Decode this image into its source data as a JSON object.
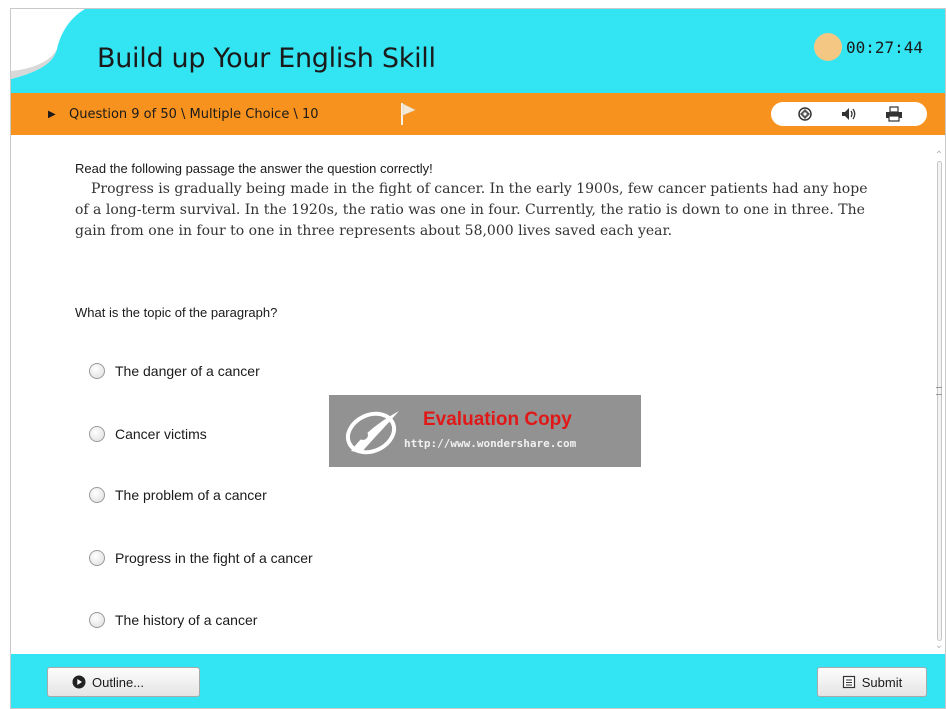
{
  "app": {
    "title": "Build up Your English Skill",
    "timer": "00:27:44"
  },
  "question_bar": {
    "text": "Question 9 of 50 \\ Multiple Choice \\ 10"
  },
  "tools": {
    "icons": [
      "tag-icon",
      "audio-icon",
      "print-icon"
    ]
  },
  "content": {
    "instruction": "Read the following passage the answer the question correctly!",
    "passage": "Progress is gradually being made in the fight of cancer. In the early 1900s, few cancer patients had any hope of a long-term survival. In the 1920s, the ratio was one in four. Currently, the ratio is down to one in three. The gain from one in four to one in three represents about 58,000 lives saved each year.",
    "question": "What is the topic of the paragraph?",
    "options": [
      "The danger of a cancer",
      "Cancer victims",
      "The problem of a cancer",
      "Progress in the fight of a cancer",
      "The history of a cancer"
    ]
  },
  "watermark": {
    "title": "Evaluation Copy",
    "url": "http://www.wondershare.com"
  },
  "footer": {
    "outline_label": "Outline...",
    "submit_label": "Submit"
  },
  "colors": {
    "header": "#33e4f2",
    "question_bar": "#f7921e",
    "timer": "#f4c882"
  }
}
